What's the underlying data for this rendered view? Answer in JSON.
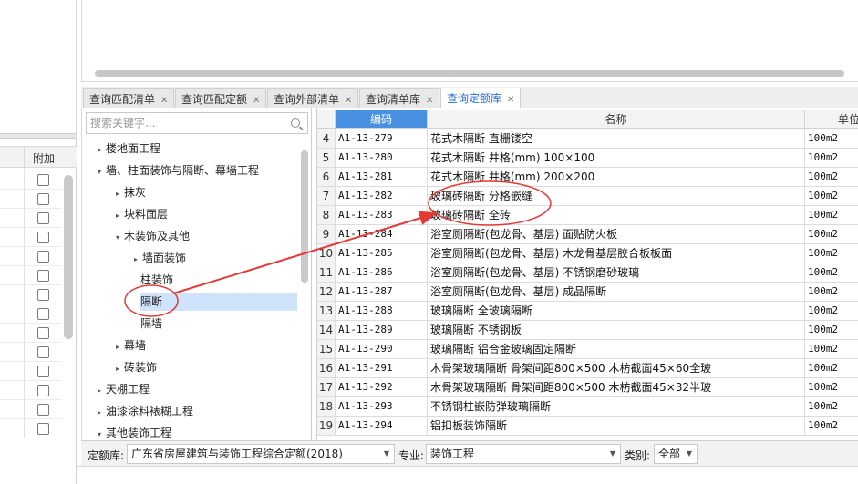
{
  "left_panel": {
    "column_header": "附加",
    "checkbox_count": 14
  },
  "tabs": [
    {
      "label": "查询匹配清单",
      "active": false
    },
    {
      "label": "查询匹配定额",
      "active": false
    },
    {
      "label": "查询外部清单",
      "active": false
    },
    {
      "label": "查询清单库",
      "active": false
    },
    {
      "label": "查询定额库",
      "active": true
    }
  ],
  "tree": {
    "search_placeholder": "搜索关键字...",
    "items": [
      {
        "label": "楼地面工程",
        "arrow": "▸"
      },
      {
        "label": "墙、柱面装饰与隔断、幕墙工程",
        "arrow": "▾"
      },
      {
        "label": "抹灰",
        "arrow": "▸"
      },
      {
        "label": "块料面层",
        "arrow": "▸"
      },
      {
        "label": "木装饰及其他",
        "arrow": "▾"
      },
      {
        "label": "墙面装饰",
        "arrow": "▸"
      },
      {
        "label": "柱装饰",
        "arrow": ""
      },
      {
        "label": "隔断",
        "arrow": "",
        "selected": true
      },
      {
        "label": "隔墙",
        "arrow": ""
      },
      {
        "label": "幕墙",
        "arrow": "▸"
      },
      {
        "label": "砖装饰",
        "arrow": "▸"
      },
      {
        "label": "天棚工程",
        "arrow": "▸"
      },
      {
        "label": "油漆涂料裱糊工程",
        "arrow": "▸"
      },
      {
        "label": "其他装饰工程",
        "arrow": "▾"
      }
    ]
  },
  "grid": {
    "headers": {
      "code": "编码",
      "name": "名称",
      "unit": "单位"
    },
    "rows": [
      {
        "num": "4",
        "code": "A1-13-279",
        "name": "花式木隔断 直栅镂空",
        "unit": "100m2"
      },
      {
        "num": "5",
        "code": "A1-13-280",
        "name": "花式木隔断 井格(mm) 100×100",
        "unit": "100m2"
      },
      {
        "num": "6",
        "code": "A1-13-281",
        "name": "花式木隔断 井格(mm) 200×200",
        "unit": "100m2"
      },
      {
        "num": "7",
        "code": "A1-13-282",
        "name": "玻璃砖隔断 分格嵌缝",
        "unit": "100m2"
      },
      {
        "num": "8",
        "code": "A1-13-283",
        "name": "玻璃砖隔断 全砖",
        "unit": "100m2"
      },
      {
        "num": "9",
        "code": "A1-13-284",
        "name": "浴室厕隔断(包龙骨、基层) 面贴防火板",
        "unit": "100m2"
      },
      {
        "num": "10",
        "code": "A1-13-285",
        "name": "浴室厕隔断(包龙骨、基层) 木龙骨基层胶合板板面",
        "unit": "100m2"
      },
      {
        "num": "11",
        "code": "A1-13-286",
        "name": "浴室厕隔断(包龙骨、基层) 不锈钢磨砂玻璃",
        "unit": "100m2"
      },
      {
        "num": "12",
        "code": "A1-13-287",
        "name": "浴室厕隔断(包龙骨、基层) 成品隔断",
        "unit": "100m2"
      },
      {
        "num": "13",
        "code": "A1-13-288",
        "name": "玻璃隔断 全玻璃隔断",
        "unit": "100m2"
      },
      {
        "num": "14",
        "code": "A1-13-289",
        "name": "玻璃隔断 不锈钢板",
        "unit": "100m2"
      },
      {
        "num": "15",
        "code": "A1-13-290",
        "name": "玻璃隔断 铝合金玻璃固定隔断",
        "unit": "100m2"
      },
      {
        "num": "16",
        "code": "A1-13-291",
        "name": "木骨架玻璃隔断 骨架间距800×500 木枋截面45×60全玻",
        "unit": "100m2"
      },
      {
        "num": "17",
        "code": "A1-13-292",
        "name": "木骨架玻璃隔断 骨架间距800×500 木枋截面45×32半玻",
        "unit": "100m2"
      },
      {
        "num": "18",
        "code": "A1-13-293",
        "name": "不锈钢柱嵌防弹玻璃隔断",
        "unit": "100m2"
      },
      {
        "num": "19",
        "code": "A1-13-294",
        "name": "铝扣板装饰隔断",
        "unit": "100m2"
      }
    ]
  },
  "bottom": {
    "quota_label": "定额库:",
    "quota_value": "广东省房屋建筑与装饰工程综合定额(2018)",
    "major_label": "专业:",
    "major_value": "装饰工程",
    "category_label": "类别:",
    "category_value": "全部"
  },
  "colors": {
    "active_tab_text": "#2a6fd6",
    "code_header_bg": "#4a90e2",
    "selected_tree_bg": "#cfe3fb",
    "annotation_red": "#e53935"
  }
}
